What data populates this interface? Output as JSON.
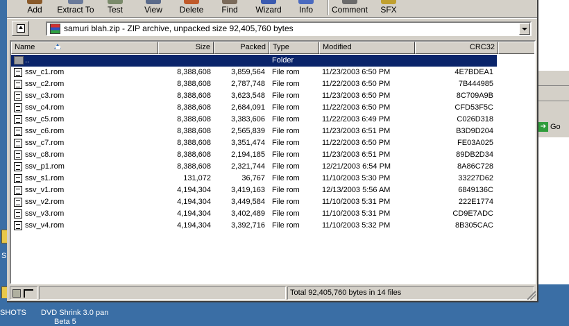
{
  "toolbar": {
    "buttons": [
      {
        "label": "Add"
      },
      {
        "label": "Extract To"
      },
      {
        "label": "Test"
      },
      {
        "label": "View"
      },
      {
        "label": "Delete"
      },
      {
        "label": "Find"
      },
      {
        "label": "Wizard"
      },
      {
        "label": "Info"
      },
      {
        "label": "Comment"
      },
      {
        "label": "SFX"
      }
    ]
  },
  "address": {
    "value": "samuri blah.zip - ZIP archive, unpacked size 92,405,760 bytes"
  },
  "columns": {
    "name": "Name",
    "size": "Size",
    "packed": "Packed",
    "type": "Type",
    "modified": "Modified",
    "crc": "CRC32"
  },
  "parent_row": {
    "name": "..",
    "type": "Folder"
  },
  "files": [
    {
      "name": "ssv_c1.rom",
      "size": "8,388,608",
      "packed": "3,859,564",
      "type": "File rom",
      "modified": "11/23/2003 6:50 PM",
      "crc": "4E7BDEA1"
    },
    {
      "name": "ssv_c2.rom",
      "size": "8,388,608",
      "packed": "2,787,748",
      "type": "File rom",
      "modified": "11/22/2003 6:50 PM",
      "crc": "7B444985"
    },
    {
      "name": "ssv_c3.rom",
      "size": "8,388,608",
      "packed": "3,623,548",
      "type": "File rom",
      "modified": "11/23/2003 6:50 PM",
      "crc": "8C709A9B"
    },
    {
      "name": "ssv_c4.rom",
      "size": "8,388,608",
      "packed": "2,684,091",
      "type": "File rom",
      "modified": "11/22/2003 6:50 PM",
      "crc": "CFD53F5C"
    },
    {
      "name": "ssv_c5.rom",
      "size": "8,388,608",
      "packed": "3,383,606",
      "type": "File rom",
      "modified": "11/22/2003 6:49 PM",
      "crc": "C026D318"
    },
    {
      "name": "ssv_c6.rom",
      "size": "8,388,608",
      "packed": "2,565,839",
      "type": "File rom",
      "modified": "11/23/2003 6:51 PM",
      "crc": "B3D9D204"
    },
    {
      "name": "ssv_c7.rom",
      "size": "8,388,608",
      "packed": "3,351,474",
      "type": "File rom",
      "modified": "11/22/2003 6:50 PM",
      "crc": "FE03A025"
    },
    {
      "name": "ssv_c8.rom",
      "size": "8,388,608",
      "packed": "2,194,185",
      "type": "File rom",
      "modified": "11/23/2003 6:51 PM",
      "crc": "89DB2D34"
    },
    {
      "name": "ssv_p1.rom",
      "size": "8,388,608",
      "packed": "2,321,744",
      "type": "File rom",
      "modified": "12/21/2003 6:54 PM",
      "crc": "8A86C728"
    },
    {
      "name": "ssv_s1.rom",
      "size": "131,072",
      "packed": "36,767",
      "type": "File rom",
      "modified": "11/10/2003 5:30 PM",
      "crc": "33227D62"
    },
    {
      "name": "ssv_v1.rom",
      "size": "4,194,304",
      "packed": "3,419,163",
      "type": "File rom",
      "modified": "12/13/2003 5:56 AM",
      "crc": "6849136C"
    },
    {
      "name": "ssv_v2.rom",
      "size": "4,194,304",
      "packed": "3,449,584",
      "type": "File rom",
      "modified": "11/10/2003 5:31 PM",
      "crc": "222E1774"
    },
    {
      "name": "ssv_v3.rom",
      "size": "4,194,304",
      "packed": "3,402,489",
      "type": "File rom",
      "modified": "11/10/2003 5:31 PM",
      "crc": "CD9E7ADC"
    },
    {
      "name": "ssv_v4.rom",
      "size": "4,194,304",
      "packed": "3,392,716",
      "type": "File rom",
      "modified": "11/10/2003 5:32 PM",
      "crc": "8B305CAC"
    }
  ],
  "status": {
    "total": "Total 92,405,760 bytes in 14 files"
  },
  "background_window": {
    "go_label": "Go"
  },
  "desktop": {
    "icon1": "SHOTS",
    "icon2_line1": "DVD Shrink 3.0",
    "icon2_line2": "Beta 5",
    "icon3": "pan",
    "edge_letter": "S"
  }
}
